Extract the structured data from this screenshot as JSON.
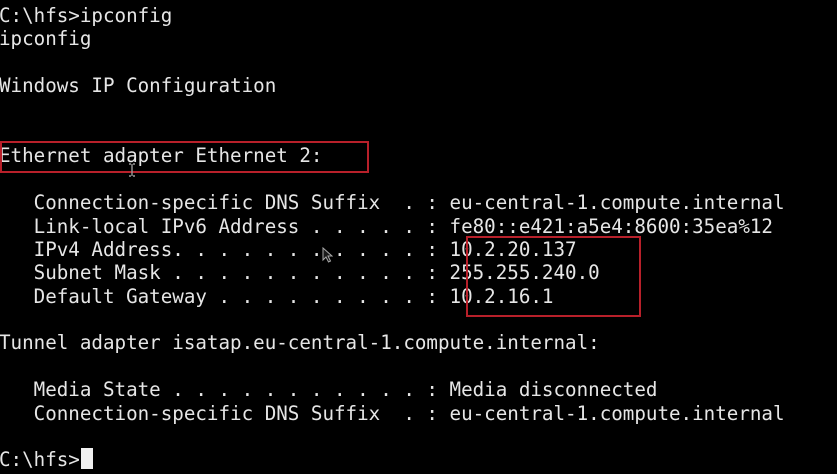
{
  "terminal": {
    "lines": [
      "C:\\hfs>ipconfig",
      "ipconfig",
      "",
      "Windows IP Configuration",
      "",
      "",
      "Ethernet adapter Ethernet 2:",
      "",
      "   Connection-specific DNS Suffix  . : eu-central-1.compute.internal",
      "   Link-local IPv6 Address . . . . . : fe80::e421:a5e4:8600:35ea%12",
      "   IPv4 Address. . . . . . . . . . . : 10.2.20.137",
      "   Subnet Mask . . . . . . . . . . . : 255.255.240.0",
      "   Default Gateway . . . . . . . . . : 10.2.16.1",
      "",
      "Tunnel adapter isatap.eu-central-1.compute.internal:",
      "",
      "   Media State . . . . . . . . . . . : Media disconnected",
      "   Connection-specific DNS Suffix  . : eu-central-1.compute.internal",
      "",
      "C:\\hfs>"
    ]
  },
  "colors": {
    "background": "#000000",
    "foreground": "#e6e6e6",
    "highlight_border": "#b8202a",
    "cursor": "#f0f0f0"
  },
  "icons": {
    "mouse_pointer": "arrow-pointer-icon",
    "text_cursor": "i-beam-cursor-icon"
  }
}
